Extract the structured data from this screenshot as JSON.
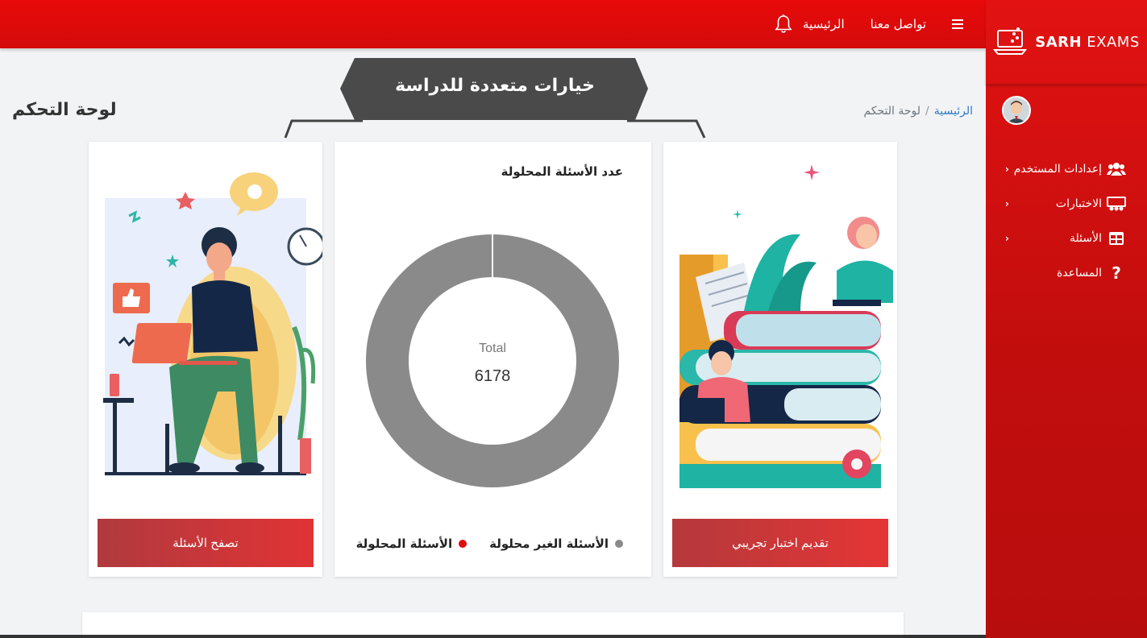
{
  "brand": {
    "name_bold": "SARH",
    "name_rest": " EXAMS"
  },
  "topnav": {
    "contact": "تواصل معنا",
    "home": "الرئيسية"
  },
  "sidebar": {
    "items": [
      {
        "label": "إعدادات المستخدم",
        "icon": "users-icon",
        "has_chevron": true
      },
      {
        "label": "الاختبارات",
        "icon": "exams-icon",
        "has_chevron": true
      },
      {
        "label": "الأسئلة",
        "icon": "table-icon",
        "has_chevron": true
      },
      {
        "label": "المساعدة",
        "icon": "question-icon",
        "has_chevron": false
      }
    ]
  },
  "page": {
    "title": "لوحة التحكم",
    "breadcrumb_home": "الرئيسية",
    "breadcrumb_sep": "/",
    "breadcrumb_current": "لوحة التحكم"
  },
  "banner": {
    "text": "خيارات متعددة للدراسة"
  },
  "cards": {
    "browse_button": "تصفح الأسئلة",
    "trial_button": "تقديم اختبار تجريبي"
  },
  "chart_data": {
    "type": "pie",
    "title": "عدد الأسئلة المحلولة",
    "center_label": "Total",
    "center_value": "6178",
    "series": [
      {
        "name": "الأسئلة الغير محلولة",
        "value": 6178,
        "color": "#8a8a8a"
      },
      {
        "name": "الأسئلة المحلولة",
        "value": 0,
        "color": "#e00b0b"
      }
    ],
    "legend_position": "bottom"
  },
  "colors": {
    "accent": "#e00b0b",
    "sidebar": "#c90e0e"
  }
}
